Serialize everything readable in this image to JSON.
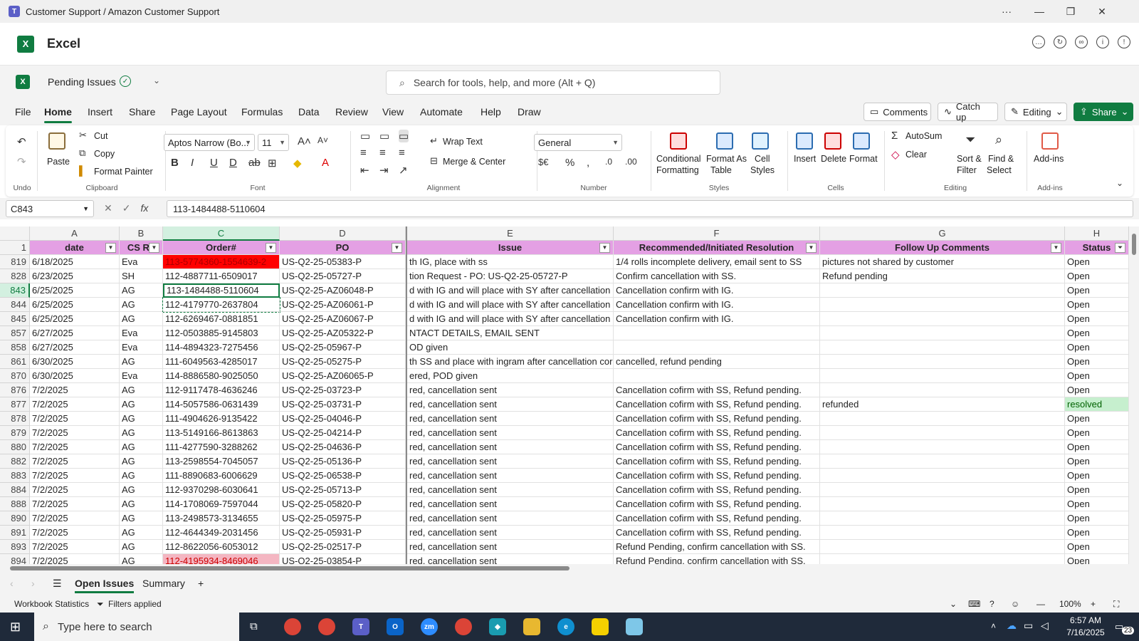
{
  "window": {
    "title": "Customer Support / Amazon Customer Support"
  },
  "app": {
    "name": "Excel"
  },
  "doc": {
    "name": "Pending Issues",
    "search_placeholder": "Search for tools, help, and more (Alt + Q)"
  },
  "tabs": [
    "File",
    "Home",
    "Insert",
    "Share",
    "Page Layout",
    "Formulas",
    "Data",
    "Review",
    "View",
    "Automate",
    "Help",
    "Draw"
  ],
  "tab_buttons": {
    "comments": "Comments",
    "catchup": "Catch up",
    "editing": "Editing",
    "share": "Share"
  },
  "ribbon": {
    "undo_group": "Undo",
    "clipboard": {
      "paste": "Paste",
      "cut": "Cut",
      "copy": "Copy",
      "format_painter": "Format Painter",
      "label": "Clipboard"
    },
    "font": {
      "family": "Aptos Narrow (Bo...",
      "size": "11",
      "label": "Font"
    },
    "alignment": {
      "wrap": "Wrap Text",
      "merge": "Merge & Center",
      "label": "Alignment"
    },
    "number": {
      "format": "General",
      "label": "Number"
    },
    "styles": {
      "conditional": "Conditional",
      "conditional2": "Formatting",
      "format_as": "Format As",
      "format_as2": "Table",
      "cell": "Cell",
      "cell2": "Styles",
      "label": "Styles"
    },
    "cells": {
      "insert": "Insert",
      "delete": "Delete",
      "format": "Format",
      "label": "Cells"
    },
    "editing": {
      "autosum": "AutoSum",
      "clear": "Clear",
      "sort": "Sort &",
      "sort2": "Filter",
      "find": "Find &",
      "find2": "Select",
      "label": "Editing"
    },
    "addins": {
      "name": "Add-ins",
      "label": "Add-ins"
    }
  },
  "formula_bar": {
    "name_box": "C843",
    "formula": "113-1484488-5110604"
  },
  "columns": [
    "A",
    "B",
    "C",
    "D",
    "E",
    "F",
    "G",
    "H"
  ],
  "header_row": {
    "num": "1",
    "cells": [
      "date",
      "CS Re",
      "Order#",
      "PO",
      "Issue",
      "Recommended/Initiated Resolution",
      "Follow Up Comments",
      "Status"
    ]
  },
  "rows": [
    {
      "num": "819",
      "cells": [
        "6/18/2025",
        "Eva",
        "113-5774360-1554639-2",
        "US-Q2-25-05383-P",
        "th IG, place with ss",
        "1/4 rolls incomplete delivery, email sent to SS",
        "pictures not shared by customer",
        "Open"
      ]
    },
    {
      "num": "828",
      "cells": [
        "6/23/2025",
        "SH",
        "112-4887711-6509017",
        "US-Q2-25-05727-P",
        "tion Request - PO: US-Q2-25-05727-P",
        "Confirm cancellation with SS.",
        "Refund pending",
        "Open"
      ]
    },
    {
      "num": "843",
      "cells": [
        "6/25/2025",
        "AG",
        "113-1484488-5110604",
        "US-Q2-25-AZ06048-P",
        "d with IG and will place with SY after cancellation c",
        "Cancellation confirm with IG.",
        "",
        "Open"
      ]
    },
    {
      "num": "844",
      "cells": [
        "6/25/2025",
        "AG",
        "112-4179770-2637804",
        "US-Q2-25-AZ06061-P",
        "d with IG and will place with SY after cancellation c",
        "Cancellation confirm with IG.",
        "",
        "Open"
      ]
    },
    {
      "num": "845",
      "cells": [
        "6/25/2025",
        "AG",
        "112-6269467-0881851",
        "US-Q2-25-AZ06067-P",
        "d with IG and will place with SY after cancellation c",
        "Cancellation confirm with IG.",
        "",
        "Open"
      ]
    },
    {
      "num": "857",
      "cells": [
        "6/27/2025",
        "Eva",
        "112-0503885-9145803",
        "US-Q2-25-AZ05322-P",
        "NTACT DETAILS, EMAIL SENT",
        "",
        "",
        "Open"
      ]
    },
    {
      "num": "858",
      "cells": [
        "6/27/2025",
        "Eva",
        "114-4894323-7275456",
        " US-Q2-25-05967-P",
        "OD given",
        "",
        "",
        "Open"
      ]
    },
    {
      "num": "861",
      "cells": [
        "6/30/2025",
        "AG",
        "111-6049563-4285017",
        "US-Q2-25-05275-P",
        "th SS and place with ingram after cancellation cor",
        "cancelled, refund pending",
        "",
        "Open"
      ]
    },
    {
      "num": "870",
      "cells": [
        "6/30/2025",
        "Eva",
        "114-8886580-9025050",
        "US-Q2-25-AZ06065-P",
        "ered, POD given",
        "",
        "",
        "Open"
      ]
    },
    {
      "num": "876",
      "cells": [
        "7/2/2025",
        "AG",
        "112-9117478-4636246",
        "US-Q2-25-03723-P",
        "red, cancellation sent",
        "Cancellation cofirm with SS, Refund pending.",
        "",
        "Open"
      ]
    },
    {
      "num": "877",
      "cells": [
        "7/2/2025",
        "AG",
        "114-5057586-0631439",
        "US-Q2-25-03731-P",
        "red, cancellation sent",
        "Cancellation cofirm with SS, Refund pending.",
        "refunded",
        "resolved"
      ]
    },
    {
      "num": "878",
      "cells": [
        "7/2/2025",
        "AG",
        "111-4904626-9135422",
        "US-Q2-25-04046-P",
        "red, cancellation sent",
        "Cancellation cofirm with SS, Refund pending.",
        "",
        "Open"
      ]
    },
    {
      "num": "879",
      "cells": [
        "7/2/2025",
        "AG",
        "113-5149166-8613863",
        "US-Q2-25-04214-P",
        "red, cancellation sent",
        "Cancellation cofirm with SS, Refund pending.",
        "",
        "Open"
      ]
    },
    {
      "num": "880",
      "cells": [
        "7/2/2025",
        "AG",
        "111-4277590-3288262",
        "US-Q2-25-04636-P",
        "red, cancellation sent",
        "Cancellation cofirm with SS, Refund pending.",
        "",
        "Open"
      ]
    },
    {
      "num": "882",
      "cells": [
        "7/2/2025",
        "AG",
        "113-2598554-7045057",
        "US-Q2-25-05136-P",
        "red, cancellation sent",
        "Cancellation cofirm with SS, Refund pending.",
        "",
        "Open"
      ]
    },
    {
      "num": "883",
      "cells": [
        "7/2/2025",
        "AG",
        "111-8890683-6006629",
        "US-Q2-25-06538-P",
        "red, cancellation sent",
        "Cancellation cofirm with SS, Refund pending.",
        "",
        "Open"
      ]
    },
    {
      "num": "884",
      "cells": [
        "7/2/2025",
        "AG",
        "112-9370298-6030641",
        "US-Q2-25-05713-P",
        "red, cancellation sent",
        "Cancellation cofirm with SS, Refund pending.",
        "",
        "Open"
      ]
    },
    {
      "num": "888",
      "cells": [
        "7/2/2025",
        "AG",
        "114-1708069-7597044",
        "US-Q2-25-05820-P",
        "red, cancellation sent",
        "Cancellation cofirm with SS, Refund pending.",
        "",
        "Open"
      ]
    },
    {
      "num": "890",
      "cells": [
        "7/2/2025",
        "AG",
        "113-2498573-3134655",
        "US-Q2-25-05975-P",
        "red, cancellation sent",
        "Cancellation cofirm with SS, Refund pending.",
        "",
        "Open"
      ]
    },
    {
      "num": "891",
      "cells": [
        "7/2/2025",
        "AG",
        "112-4644349-2031456",
        "US-Q2-25-05931-P",
        "red, cancellation sent",
        "Cancellation cofirm with SS, Refund pending.",
        "",
        "Open"
      ]
    },
    {
      "num": "893",
      "cells": [
        "7/2/2025",
        "AG",
        "112-8622056-6053012",
        "US-Q2-25-02517-P",
        "red, cancellation sent",
        "Refund Pending, confirm cancellation with SS.",
        "",
        "Open"
      ]
    },
    {
      "num": "894",
      "cells": [
        "7/2/2025",
        "AG",
        "112-4195934-8469046",
        "US-Q2-25-03854-P",
        "red, cancellation sent",
        "Refund Pending, confirm cancellation with SS.",
        "",
        "Open"
      ]
    }
  ],
  "highlight_colors": {
    "red": "#ff0000",
    "pink": "#f4b6c2",
    "resolved": "#c6efce",
    "header": "#e4a0e4",
    "accent": "#107c41"
  },
  "sheets": [
    "Open Issues",
    "Summary"
  ],
  "status": {
    "stats": "Workbook Statistics",
    "filters": "Filters applied",
    "zoom": "100%"
  },
  "taskbar": {
    "search": "Type here to search",
    "time": "6:57 AM",
    "date": "7/16/2025",
    "notif": "23"
  }
}
